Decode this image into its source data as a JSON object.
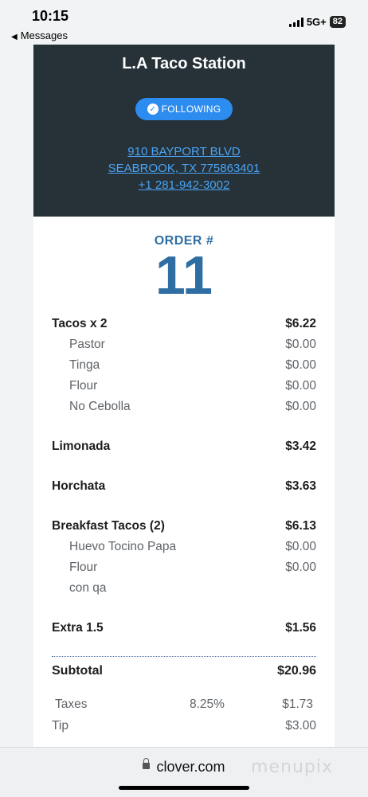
{
  "status_bar": {
    "time": "10:15",
    "back_label": "Messages",
    "network": "5G+",
    "battery": "82"
  },
  "store": {
    "name": "L.A Taco Station",
    "follow_label": "FOLLOWING",
    "address_line1": "910 BAYPORT BLVD",
    "address_line2": "SEABROOK, TX 775863401",
    "phone": "+1 281-942-3002"
  },
  "order": {
    "label": "ORDER #",
    "number": "11"
  },
  "items": [
    {
      "name": "Tacos x 2",
      "price": "$6.22",
      "mods": [
        {
          "name": "Pastor",
          "price": "$0.00"
        },
        {
          "name": "Tinga",
          "price": "$0.00"
        },
        {
          "name": "Flour",
          "price": "$0.00"
        },
        {
          "name": "No Cebolla",
          "price": "$0.00"
        }
      ]
    },
    {
      "name": "Limonada",
      "price": "$3.42",
      "mods": []
    },
    {
      "name": "Horchata",
      "price": "$3.63",
      "mods": []
    },
    {
      "name": "Breakfast Tacos (2)",
      "price": "$6.13",
      "mods": [
        {
          "name": "Huevo Tocino Papa",
          "price": "$0.00"
        },
        {
          "name": "Flour",
          "price": "$0.00"
        },
        {
          "name": "con qa",
          "price": ""
        }
      ]
    },
    {
      "name": "Extra 1.5",
      "price": "$1.56",
      "mods": []
    }
  ],
  "totals": {
    "subtotal_label": "Subtotal",
    "subtotal": "$20.96",
    "taxes_label": "Taxes",
    "taxes_rate": "8.25%",
    "taxes": "$1.73",
    "tip_label": "Tip",
    "tip": "$3.00"
  },
  "browser": {
    "url": "clover.com",
    "watermark": "menupix"
  },
  "colors": {
    "header_bg": "#263238",
    "accent_blue": "#2d8cf0",
    "order_blue": "#2f6ea3"
  }
}
